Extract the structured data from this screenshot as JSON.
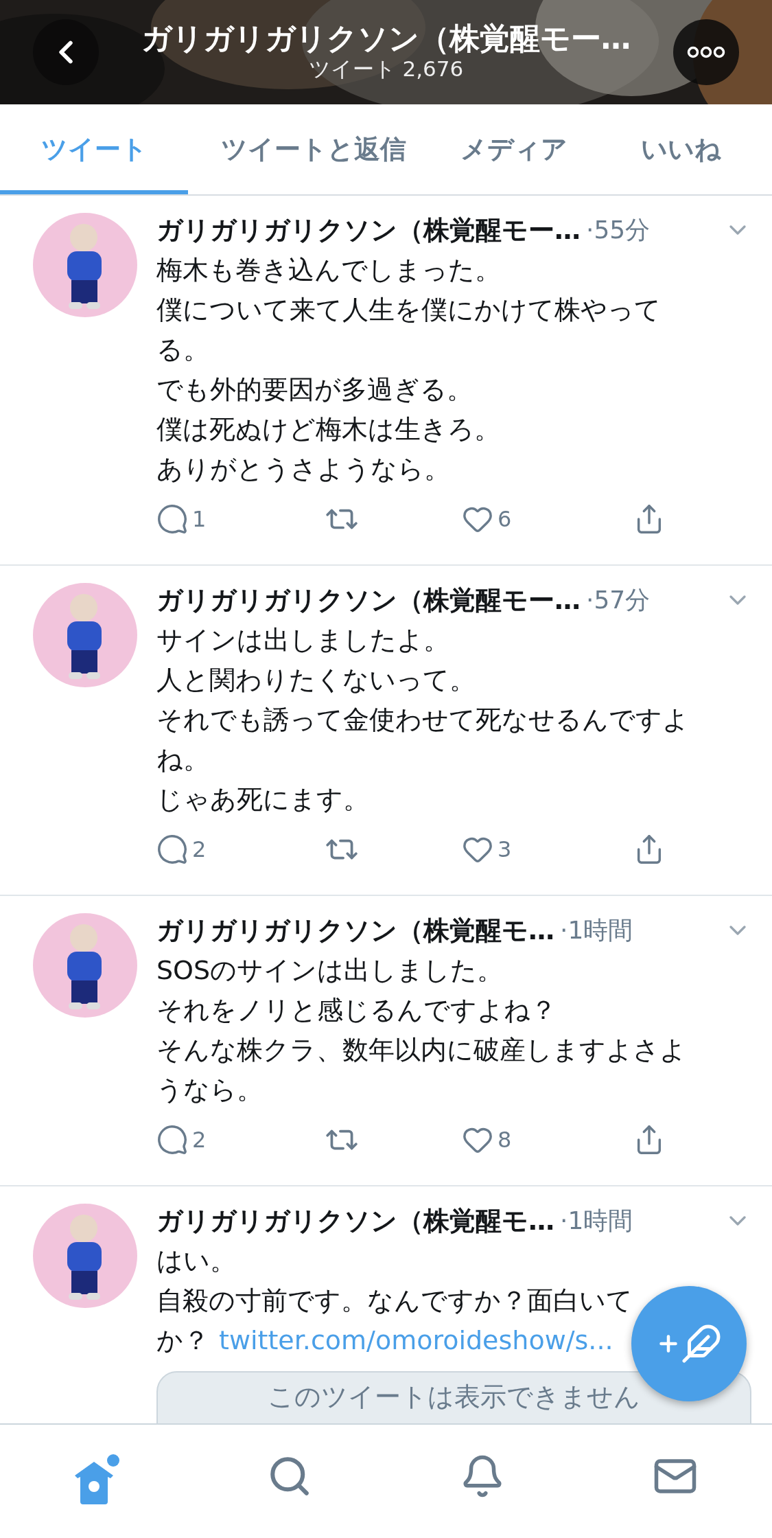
{
  "header": {
    "title": "ガリガリガリクソン（株覚醒モー…",
    "subtitle": "ツイート 2,676"
  },
  "tabs": [
    {
      "label": "ツイート",
      "selected": true
    },
    {
      "label": "ツイートと返信",
      "selected": false
    },
    {
      "label": "メディア",
      "selected": false
    },
    {
      "label": "いいね",
      "selected": false
    }
  ],
  "tweets": [
    {
      "name": "ガリガリガリクソン（株覚醒モー…",
      "time": "·55分",
      "lines": [
        "梅木も巻き込んでしまった。",
        "僕について来て人生を僕にかけて株やって",
        "る。",
        "でも外的要因が多過ぎる。",
        "僕は死ぬけど梅木は生きろ。",
        "ありがとうさようなら。"
      ],
      "replies": "1",
      "likes": "6"
    },
    {
      "name": "ガリガリガリクソン（株覚醒モー…",
      "time": "·57分",
      "lines": [
        "サインは出しましたよ。",
        "人と関わりたくないって。",
        "それでも誘って金使わせて死なせるんですよ",
        "ね。",
        "じゃあ死にます。"
      ],
      "replies": "2",
      "likes": "3"
    },
    {
      "name": "ガリガリガリクソン（株覚醒モ…",
      "time": "·1時間",
      "lines": [
        "SOSのサインは出しました。",
        "それをノリと感じるんですよね？",
        "そんな株クラ、数年以内に破産しますよさよ",
        "うなら。"
      ],
      "replies": "2",
      "likes": "8"
    },
    {
      "name": "ガリガリガリクソン（株覚醒モ…",
      "time": "·1時間",
      "lines": [
        "はい。",
        "自殺の寸前です。なんですか？面白いて",
        "か？"
      ],
      "link": "twitter.com/omoroideshow/s...",
      "quote": "このツイートは表示できません"
    }
  ],
  "nav": [
    {
      "kind": "home",
      "selected": true
    },
    {
      "kind": "search",
      "selected": false
    },
    {
      "kind": "notifications",
      "selected": false
    },
    {
      "kind": "messages",
      "selected": false
    }
  ]
}
